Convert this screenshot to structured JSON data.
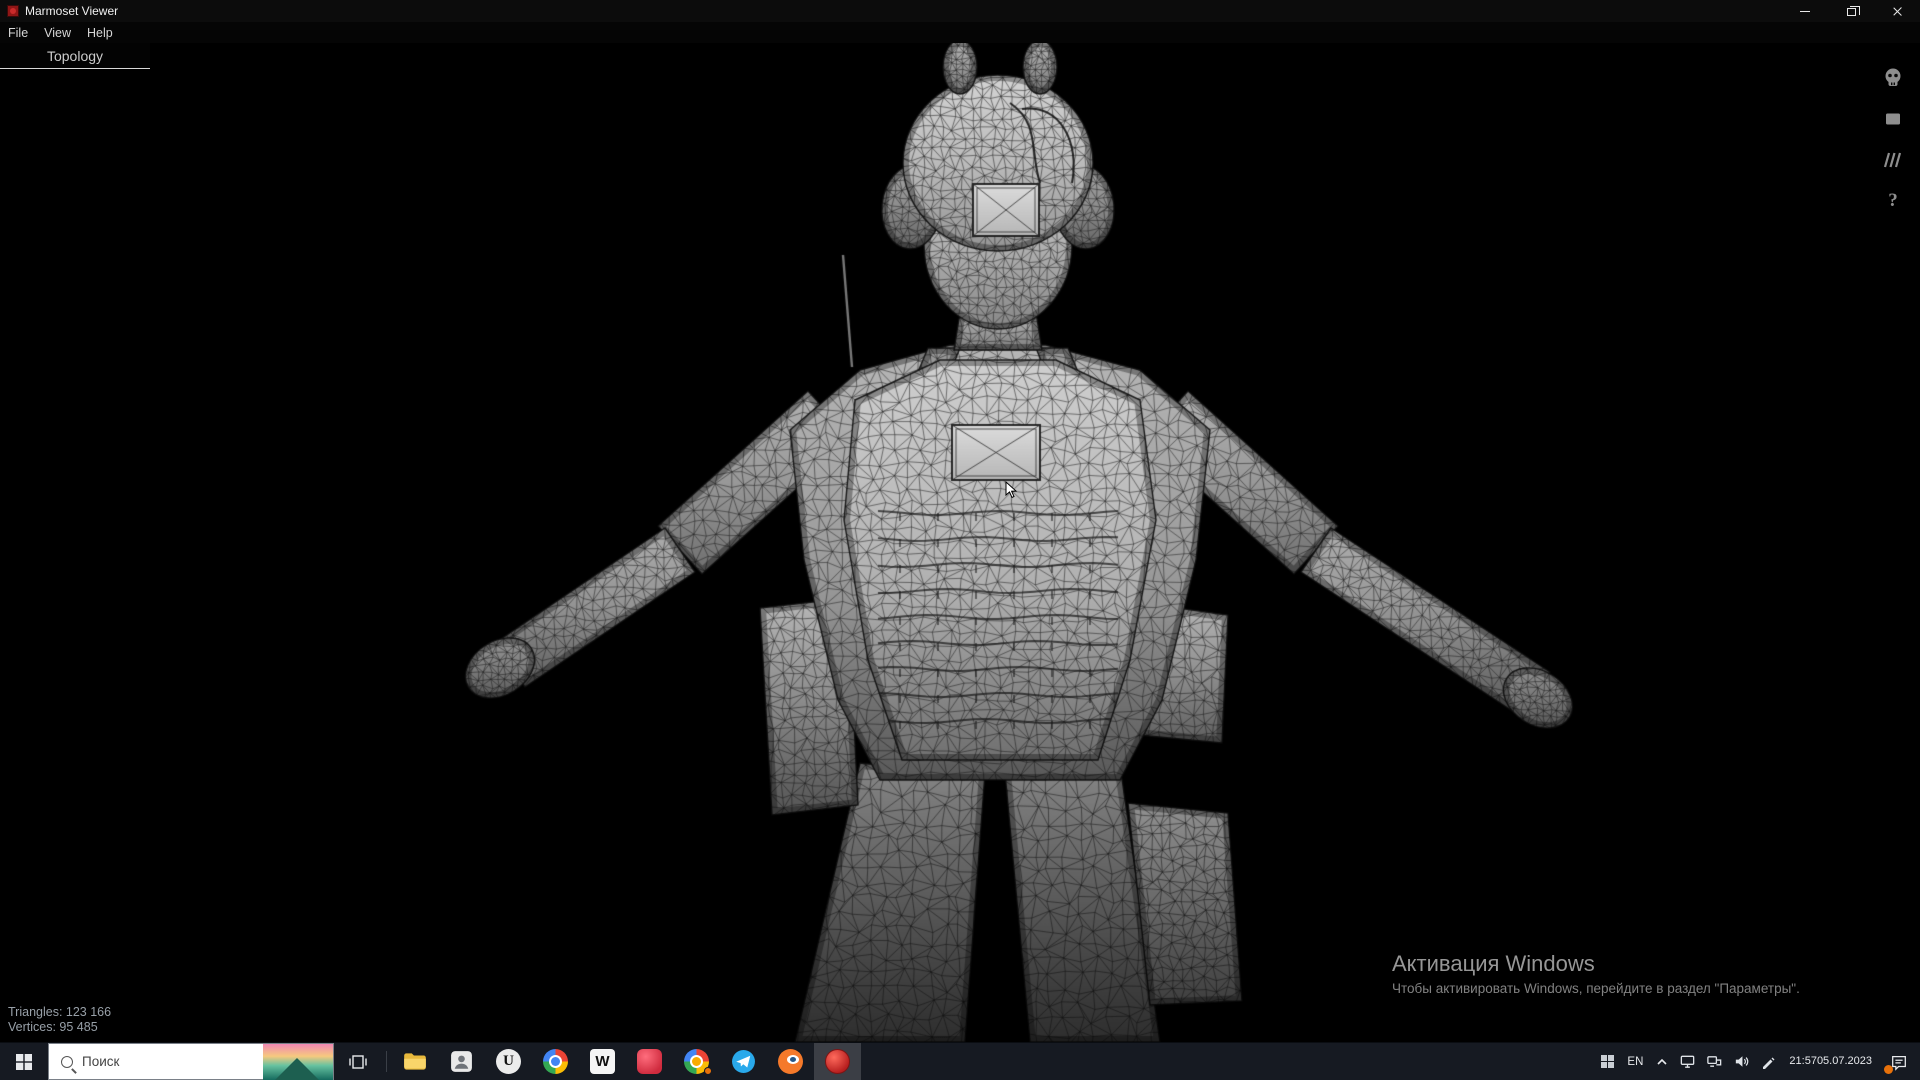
{
  "window": {
    "title": "Marmoset Viewer"
  },
  "menubar": {
    "items": [
      {
        "label": "File"
      },
      {
        "label": "View"
      },
      {
        "label": "Help"
      }
    ]
  },
  "tabbar": {
    "active_tab": "Topology"
  },
  "viewport": {
    "stats": {
      "triangles_label": "Triangles: 123 166",
      "vertices_label": "Vertices: 95 485"
    },
    "activation": {
      "line1": "Активация Windows",
      "line2": "Чтобы активировать Windows, перейдите в раздел \"Параметры\"."
    },
    "side_toolbar": {
      "help_glyph": "?"
    }
  },
  "taskbar": {
    "search": {
      "placeholder": "Поиск"
    },
    "apps": {
      "unreal_letter": "U",
      "w_letter": "W"
    },
    "tray": {
      "language": "EN",
      "time": "21:57",
      "date": "05.07.2023"
    }
  },
  "colors": {
    "app_icon_red": "#c92a2a",
    "taskbar_bg": "#161a22",
    "viewport_bg": "#000000",
    "wireframe_grey": "#b5b5b5"
  }
}
